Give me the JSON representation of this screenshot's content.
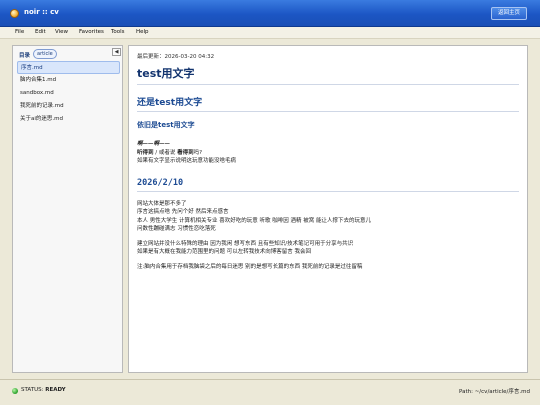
{
  "window": {
    "title": "noir :: cv",
    "home_button": "返回主页"
  },
  "menu": [
    "File",
    "Edit",
    "View",
    "Favorites",
    "Tools",
    "Help"
  ],
  "sidebar": {
    "heading": "目录",
    "tag": "article",
    "collapse": "◀",
    "files": [
      "序言.md",
      "脑内合集1.md",
      "sandbox.md",
      "我死前的记录.md",
      "关于ai的迷思.md"
    ],
    "active_index": 0
  },
  "document": {
    "updated": "最后更新：2026-03-20 04:32",
    "h1": "test用文字",
    "h2": "还是test用文字",
    "h3": "依旧是test用文字",
    "line1": "啊——啊——",
    "line2_a": "听得到",
    "line2_b": " / 或者说 ",
    "line2_c": "看得到",
    "line2_d": "吗?",
    "line3": "如果有文字显示说明这玩意功能没啥毛病",
    "date_heading": "2026/2/10",
    "para1": [
      "网站大体是那不多了",
      "序言这搞点啥 先问个好 然后来点感言",
      "本人 男性大学生 计算机相关专业 喜欢好吃的玩意 听歌 咖啡因 酒精 被窝 能让人撑下去的玩意儿",
      "问数性蹦碰满志 习惯性恋吃落死"
    ],
    "para2": [
      "建立网站并没什么特殊的理由 因为我闲 想写东西 且有些知识/技术笔记可用于分享与共识",
      "如果是有大概在我能力范围里的问题 可以左转我技术向博客留言 我会回"
    ],
    "note": "注:脑内合集用于存档我脑袋之后的每日迷思 别的是想写长篇的东西 我死前的记录是过往留稿"
  },
  "status": {
    "label": "STATUS:",
    "value": "READY",
    "path": "Path: ~/cv/article/序言.md"
  }
}
